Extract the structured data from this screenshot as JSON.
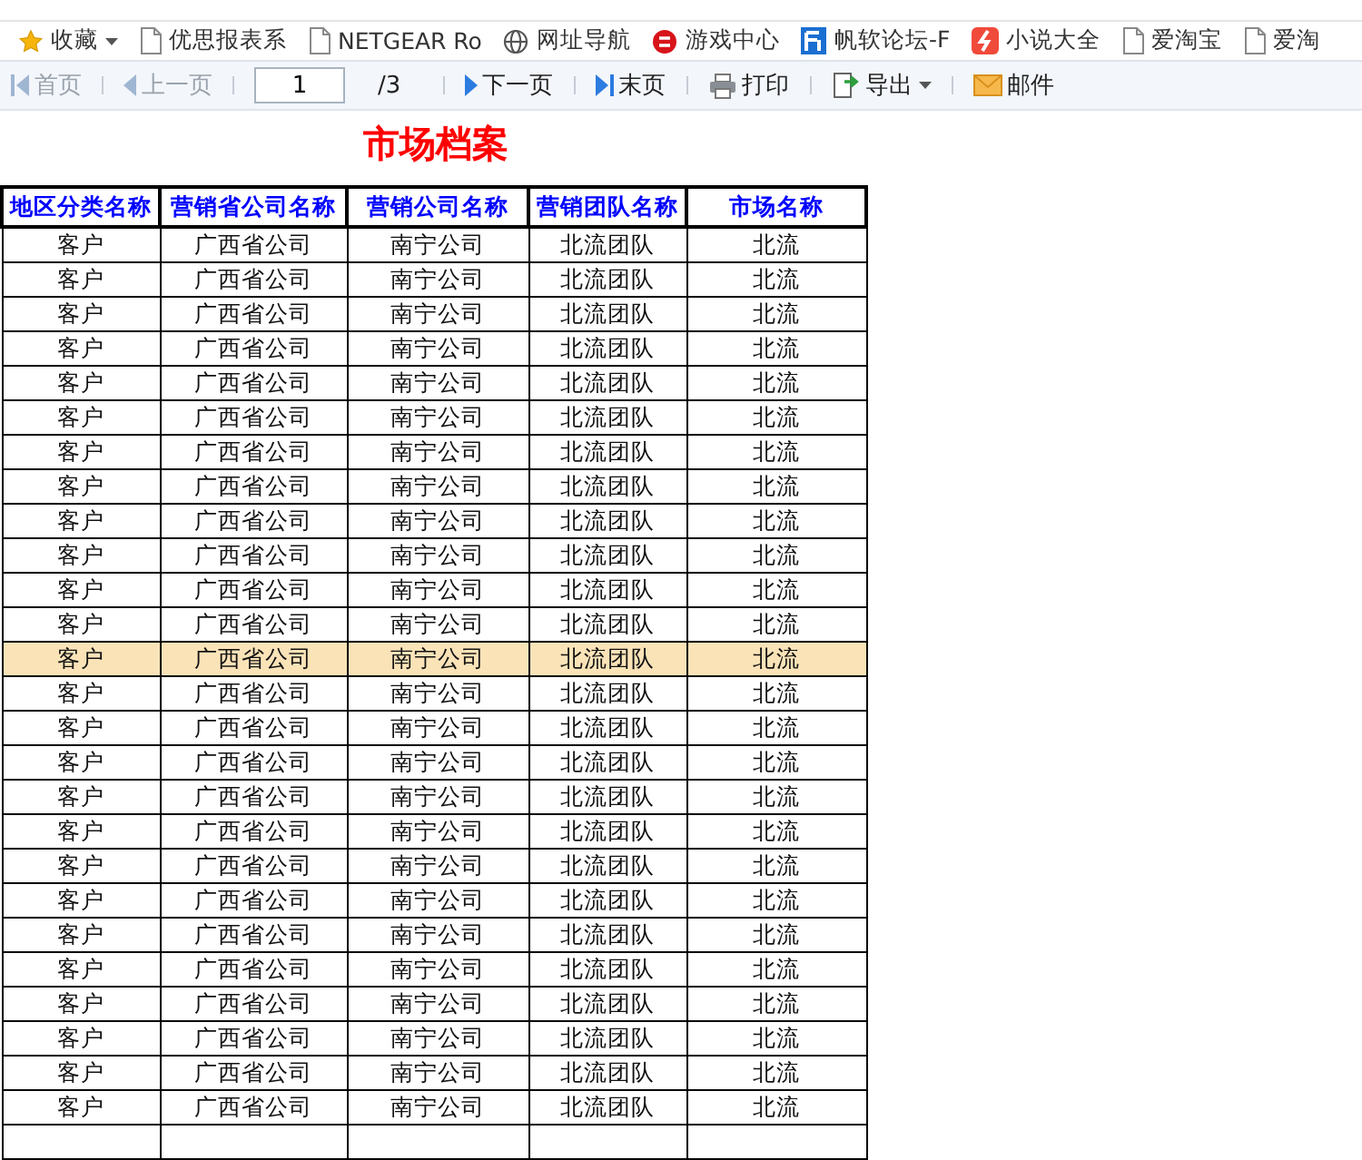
{
  "bookmarks": [
    {
      "kind": "star",
      "label": "收藏",
      "menu": true
    },
    {
      "kind": "page",
      "label": "优思报表系"
    },
    {
      "kind": "page",
      "label": "NETGEAR Ro"
    },
    {
      "kind": "globe",
      "label": "网址导航"
    },
    {
      "kind": "game",
      "label": "游戏中心"
    },
    {
      "kind": "forum",
      "label": "帆软论坛-F"
    },
    {
      "kind": "novel",
      "label": "小说大全"
    },
    {
      "kind": "page",
      "label": "爱淘宝"
    },
    {
      "kind": "page",
      "label": "爱淘"
    }
  ],
  "toolbar": {
    "first": {
      "label": "首页",
      "disabled": true
    },
    "prev": {
      "label": "上一页",
      "disabled": true
    },
    "page": {
      "value": "1",
      "total": "/3"
    },
    "next": {
      "label": "下一页",
      "disabled": false
    },
    "last": {
      "label": "末页",
      "disabled": false
    },
    "actions": [
      {
        "kind": "print",
        "label": "打印"
      },
      {
        "kind": "export",
        "label": "导出",
        "menu": true
      },
      {
        "kind": "mail",
        "label": "邮件"
      }
    ]
  },
  "title": "市场档案",
  "table": {
    "columns": [
      "地区分类名称",
      "营销省公司名称",
      "营销公司名称",
      "营销团队名称",
      "市场名称"
    ],
    "rows": [
      {
        "cells": [
          "客户",
          "广西省公司",
          "南宁公司",
          "北流团队",
          "北流"
        ],
        "selected": false
      },
      {
        "cells": [
          "客户",
          "广西省公司",
          "南宁公司",
          "北流团队",
          "北流"
        ],
        "selected": false
      },
      {
        "cells": [
          "客户",
          "广西省公司",
          "南宁公司",
          "北流团队",
          "北流"
        ],
        "selected": false
      },
      {
        "cells": [
          "客户",
          "广西省公司",
          "南宁公司",
          "北流团队",
          "北流"
        ],
        "selected": false
      },
      {
        "cells": [
          "客户",
          "广西省公司",
          "南宁公司",
          "北流团队",
          "北流"
        ],
        "selected": false
      },
      {
        "cells": [
          "客户",
          "广西省公司",
          "南宁公司",
          "北流团队",
          "北流"
        ],
        "selected": false
      },
      {
        "cells": [
          "客户",
          "广西省公司",
          "南宁公司",
          "北流团队",
          "北流"
        ],
        "selected": false
      },
      {
        "cells": [
          "客户",
          "广西省公司",
          "南宁公司",
          "北流团队",
          "北流"
        ],
        "selected": false
      },
      {
        "cells": [
          "客户",
          "广西省公司",
          "南宁公司",
          "北流团队",
          "北流"
        ],
        "selected": false
      },
      {
        "cells": [
          "客户",
          "广西省公司",
          "南宁公司",
          "北流团队",
          "北流"
        ],
        "selected": false
      },
      {
        "cells": [
          "客户",
          "广西省公司",
          "南宁公司",
          "北流团队",
          "北流"
        ],
        "selected": false
      },
      {
        "cells": [
          "客户",
          "广西省公司",
          "南宁公司",
          "北流团队",
          "北流"
        ],
        "selected": false
      },
      {
        "cells": [
          "客户",
          "广西省公司",
          "南宁公司",
          "北流团队",
          "北流"
        ],
        "selected": true
      },
      {
        "cells": [
          "客户",
          "广西省公司",
          "南宁公司",
          "北流团队",
          "北流"
        ],
        "selected": false
      },
      {
        "cells": [
          "客户",
          "广西省公司",
          "南宁公司",
          "北流团队",
          "北流"
        ],
        "selected": false
      },
      {
        "cells": [
          "客户",
          "广西省公司",
          "南宁公司",
          "北流团队",
          "北流"
        ],
        "selected": false
      },
      {
        "cells": [
          "客户",
          "广西省公司",
          "南宁公司",
          "北流团队",
          "北流"
        ],
        "selected": false
      },
      {
        "cells": [
          "客户",
          "广西省公司",
          "南宁公司",
          "北流团队",
          "北流"
        ],
        "selected": false
      },
      {
        "cells": [
          "客户",
          "广西省公司",
          "南宁公司",
          "北流团队",
          "北流"
        ],
        "selected": false
      },
      {
        "cells": [
          "客户",
          "广西省公司",
          "南宁公司",
          "北流团队",
          "北流"
        ],
        "selected": false
      },
      {
        "cells": [
          "客户",
          "广西省公司",
          "南宁公司",
          "北流团队",
          "北流"
        ],
        "selected": false
      },
      {
        "cells": [
          "客户",
          "广西省公司",
          "南宁公司",
          "北流团队",
          "北流"
        ],
        "selected": false
      },
      {
        "cells": [
          "客户",
          "广西省公司",
          "南宁公司",
          "北流团队",
          "北流"
        ],
        "selected": false
      },
      {
        "cells": [
          "客户",
          "广西省公司",
          "南宁公司",
          "北流团队",
          "北流"
        ],
        "selected": false
      },
      {
        "cells": [
          "客户",
          "广西省公司",
          "南宁公司",
          "北流团队",
          "北流"
        ],
        "selected": false
      },
      {
        "cells": [
          "客户",
          "广西省公司",
          "南宁公司",
          "北流团队",
          "北流"
        ],
        "selected": false
      }
    ]
  }
}
